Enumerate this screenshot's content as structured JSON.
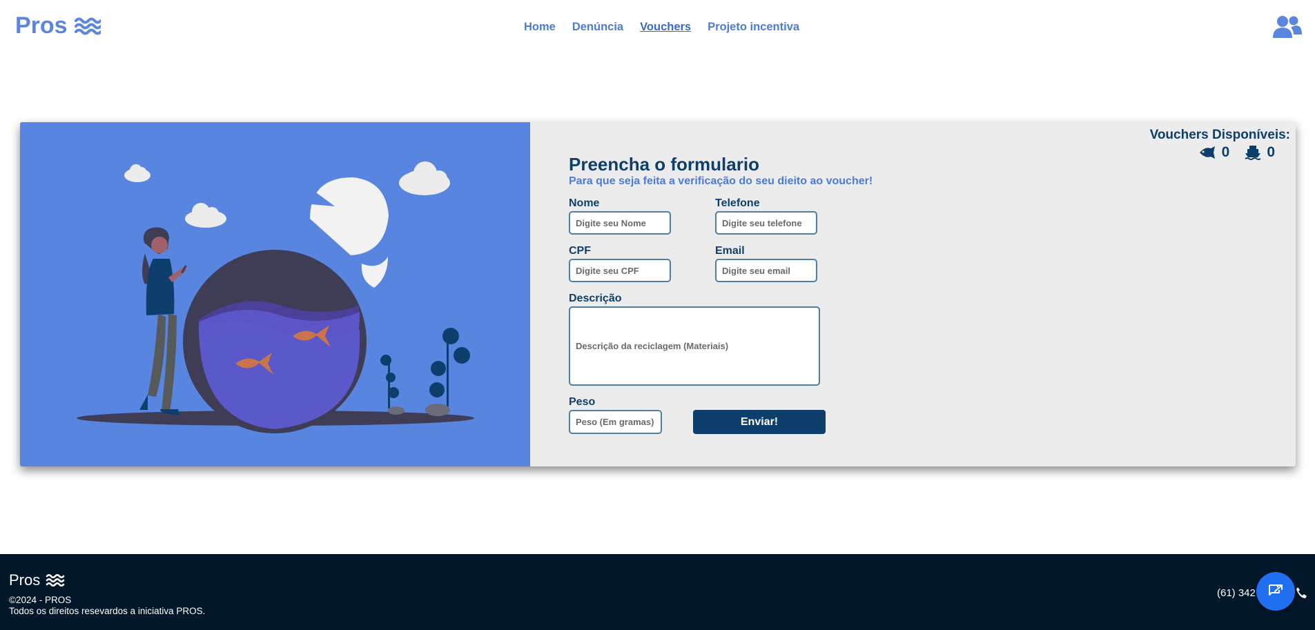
{
  "header": {
    "brand": "Pros",
    "nav": [
      "Home",
      "Denúncia",
      "Vouchers",
      "Projeto incentiva"
    ],
    "active_nav": "Vouchers"
  },
  "vouchers": {
    "title": "Vouchers Disponíveis:",
    "fish_count": "0",
    "ship_count": "0"
  },
  "form": {
    "title": "Preencha o formulario",
    "subtitle": "Para que seja feita a verificação do seu dieito ao voucher!",
    "nome_label": "Nome",
    "nome_placeholder": "Digite seu Nome",
    "telefone_label": "Telefone",
    "telefone_placeholder": "Digite seu telefone",
    "cpf_label": "CPF",
    "cpf_placeholder": "Digite seu CPF",
    "email_label": "Email",
    "email_placeholder": "Digite seu email",
    "descricao_label": "Descrição",
    "descricao_placeholder": "Descrição da reciclagem (Materiais)",
    "peso_label": "Peso",
    "peso_placeholder": "Peso (Em gramas)",
    "submit_label": "Enviar!"
  },
  "footer": {
    "brand": "Pros",
    "copyright": "©2024 - PROS",
    "rights": "Todos os direitos resevardos a iniciativa PROS.",
    "phone": "(61) 342"
  },
  "colors": {
    "brand_blue": "#5b86e0",
    "navy": "#0e3f6c",
    "footer_bg": "#02172a",
    "illustration_bg": "#5785e0",
    "chat_button": "#1f6ff0"
  },
  "icons": [
    "waves-icon",
    "users-icon",
    "fish-icon",
    "ship-icon",
    "phone-icon",
    "chat-icon"
  ]
}
